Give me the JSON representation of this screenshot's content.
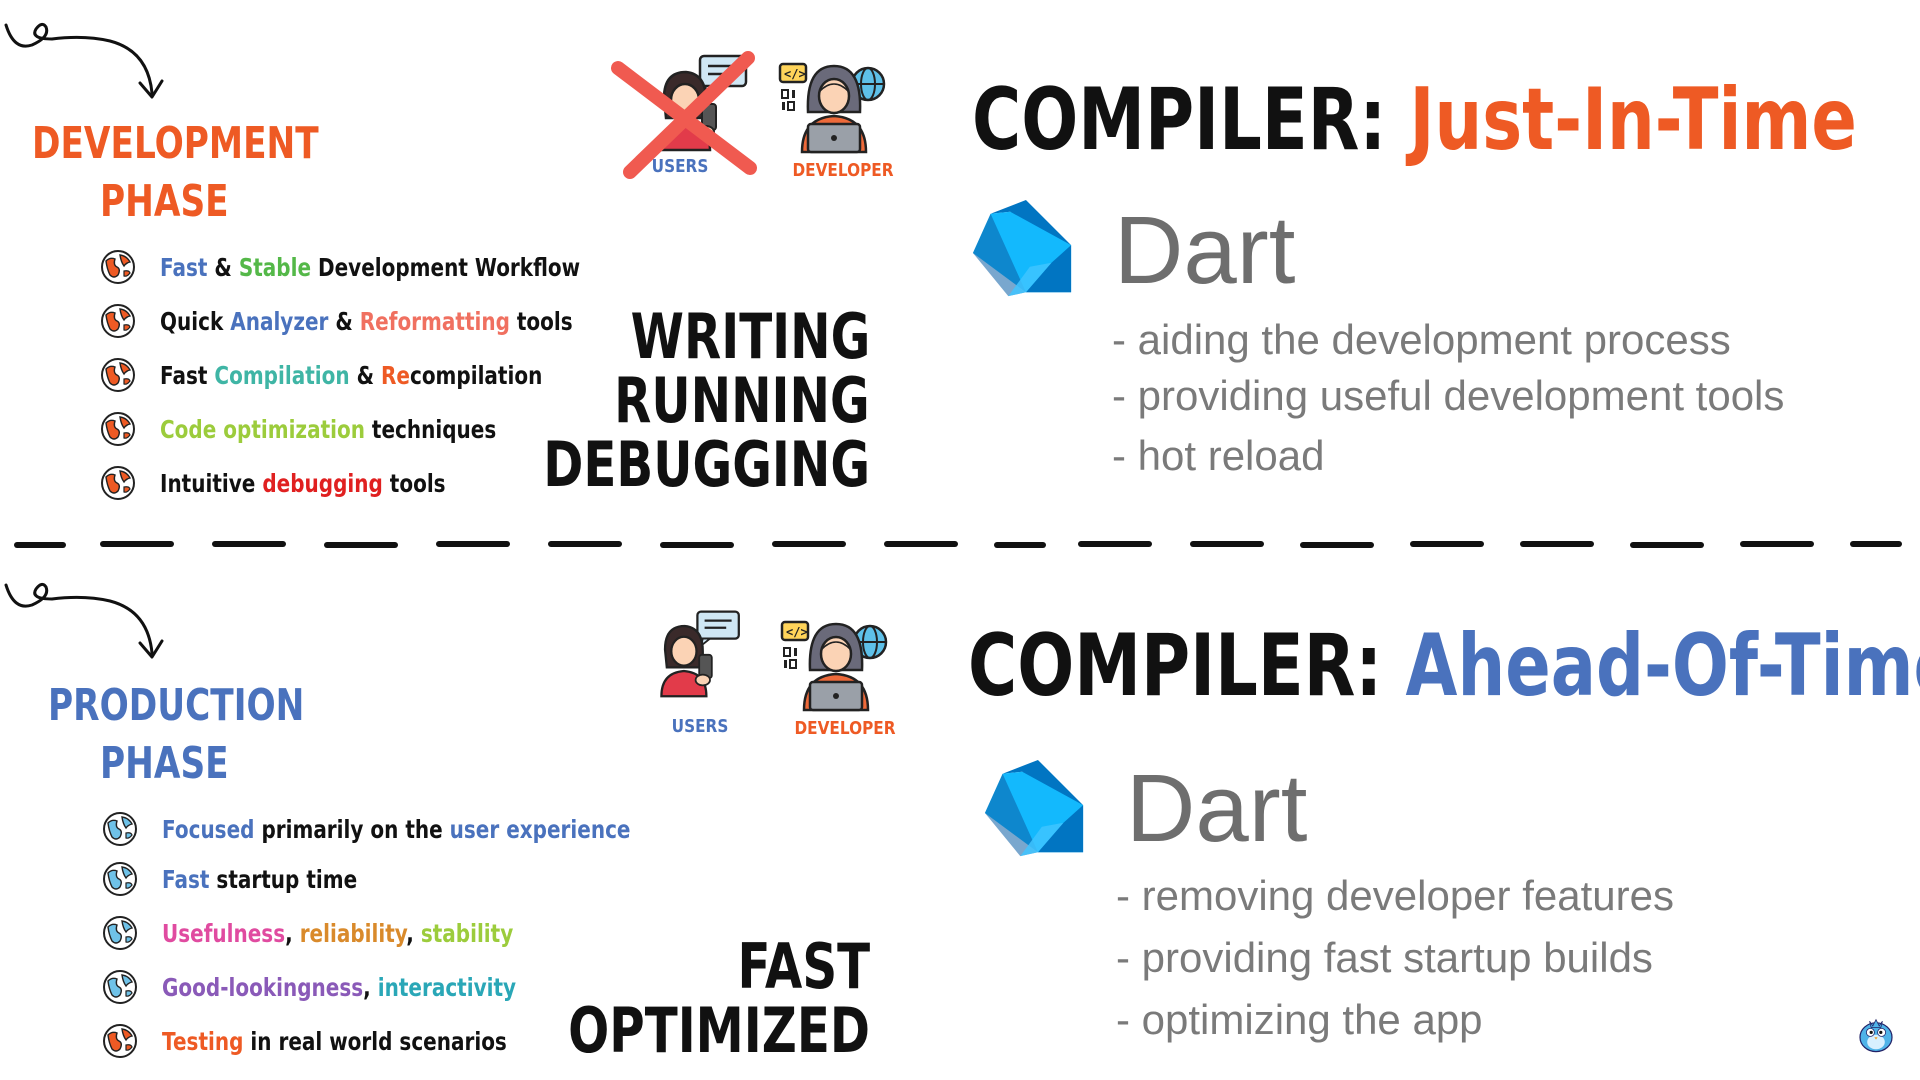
{
  "colors": {
    "dev_orange": "#ee5a24",
    "prod_blue": "#4a72bd",
    "green": "#54b848",
    "teal": "#3fb5a5",
    "lime": "#9ccc3c",
    "red": "#e02020",
    "salmon": "#f07060",
    "pink": "#e04ba0",
    "amber": "#d98a2b",
    "purple": "#8a5ab8",
    "cyan": "#2aa7b7",
    "dart_dark": "#0175c2",
    "dart_light": "#13b9fd",
    "text_gray": "#7a7a7a"
  },
  "development": {
    "title_line1": "DEVELOPMENT",
    "title_line2": "PHASE",
    "users_label": "USERS",
    "developer_label": "DEVELOPER",
    "users_crossed_out": true,
    "items": [
      {
        "segments": [
          {
            "text": "Fast",
            "color": "#4a72bd"
          },
          {
            "text": " & ",
            "color": "#111111"
          },
          {
            "text": "Stable",
            "color": "#54b848"
          },
          {
            "text": " Development Workflow",
            "color": "#111111"
          }
        ]
      },
      {
        "segments": [
          {
            "text": "Quick ",
            "color": "#111111"
          },
          {
            "text": "Analyzer",
            "color": "#4a72bd"
          },
          {
            "text": " & ",
            "color": "#111111"
          },
          {
            "text": "Reformatting",
            "color": "#f07060"
          },
          {
            "text": " tools",
            "color": "#111111"
          }
        ]
      },
      {
        "segments": [
          {
            "text": "Fast ",
            "color": "#111111"
          },
          {
            "text": "Compilation",
            "color": "#3fb5a5"
          },
          {
            "text": " & ",
            "color": "#111111"
          },
          {
            "text": "Re",
            "color": "#ee5a24"
          },
          {
            "text": "compilation",
            "color": "#111111"
          }
        ]
      },
      {
        "segments": [
          {
            "text": "Code optimization",
            "color": "#9ccc3c"
          },
          {
            "text": " techniques",
            "color": "#111111"
          }
        ]
      },
      {
        "segments": [
          {
            "text": "Intuitive ",
            "color": "#111111"
          },
          {
            "text": "debugging",
            "color": "#e02020"
          },
          {
            "text": " tools",
            "color": "#111111"
          }
        ]
      }
    ],
    "actions": [
      "WRITING",
      "RUNNING",
      "DEBUGGING"
    ],
    "compiler_label": "COMPILER:",
    "compiler_type": "Just-In-Time",
    "dart_name": "Dart",
    "features": [
      "- aiding the development process",
      "- providing useful development tools",
      "- hot reload"
    ]
  },
  "production": {
    "title_line1": "PRODUCTION",
    "title_line2": "PHASE",
    "users_label": "USERS",
    "developer_label": "DEVELOPER",
    "items": [
      {
        "segments": [
          {
            "text": "Focused",
            "color": "#4a72bd"
          },
          {
            "text": " primarily on the ",
            "color": "#111111"
          },
          {
            "text": "user experience",
            "color": "#4a72bd"
          }
        ]
      },
      {
        "segments": [
          {
            "text": "Fast",
            "color": "#4a72bd"
          },
          {
            "text": " startup time",
            "color": "#111111"
          }
        ]
      },
      {
        "segments": [
          {
            "text": "Usefulness",
            "color": "#e04ba0"
          },
          {
            "text": ", ",
            "color": "#111111"
          },
          {
            "text": "reliability",
            "color": "#d98a2b"
          },
          {
            "text": ", ",
            "color": "#111111"
          },
          {
            "text": "stability",
            "color": "#9ccc3c"
          }
        ]
      },
      {
        "segments": [
          {
            "text": "Good-lookingness",
            "color": "#8a5ab8"
          },
          {
            "text": ", ",
            "color": "#111111"
          },
          {
            "text": "interactivity",
            "color": "#2aa7b7"
          }
        ]
      },
      {
        "segments": [
          {
            "text": "Testing",
            "color": "#ee5a24"
          },
          {
            "text": " in real world scenarios",
            "color": "#111111"
          }
        ]
      }
    ],
    "actions": [
      "FAST",
      "OPTIMIZED"
    ],
    "compiler_label": "COMPILER:",
    "compiler_type": "Ahead-Of-Time",
    "dart_name": "Dart",
    "features": [
      "- removing developer features",
      "- providing fast startup builds",
      "- optimizing the app"
    ]
  },
  "icons": {
    "arrow": "curly-arrow-icon",
    "dev_bullet": "orange-globe-bullet-icon",
    "prod_bullet": "blue-globe-bullet-icon",
    "users": "user-with-chat-icon",
    "developer": "developer-with-laptop-icon",
    "dart": "dart-logo-icon",
    "mascot": "dash-mascot-icon"
  }
}
